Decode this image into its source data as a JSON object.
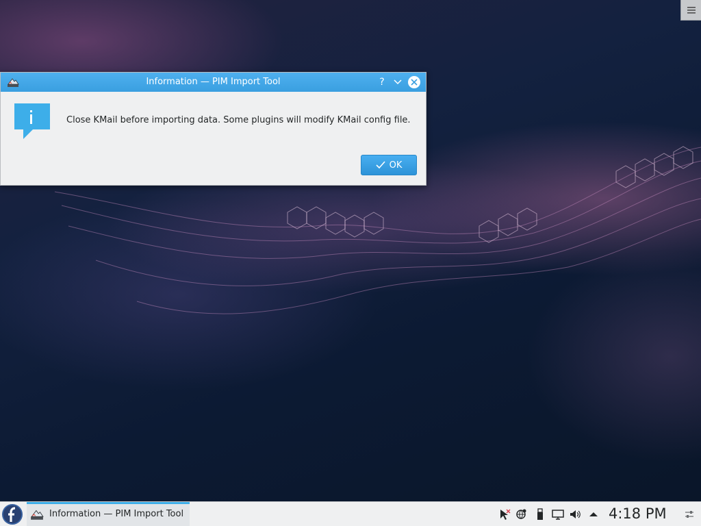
{
  "dialog": {
    "title": "Information — PIM Import Tool",
    "help_glyph": "?",
    "message": "Close KMail before importing data. Some plugins will modify KMail config file.",
    "ok_label": "OK",
    "icon": "information-icon",
    "accent_color": "#3daee9"
  },
  "taskbar": {
    "launcher_icon": "fedora-logo-icon",
    "task_label": "Information — PIM Import Tool",
    "tray_icons": [
      "mouse-disabled-icon",
      "network-icon",
      "usb-device-icon",
      "display-icon",
      "volume-icon",
      "expand-arrow-icon"
    ],
    "clock": "4:18 PM",
    "settings_icon": "panel-settings-icon"
  },
  "desktop": {
    "corner_menu_icon": "hamburger-menu-icon"
  }
}
